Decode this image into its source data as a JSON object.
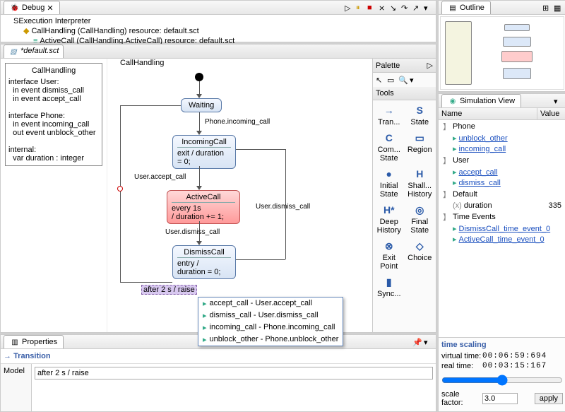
{
  "debug": {
    "title": "Debug",
    "tree": [
      {
        "icon": "▢",
        "text": "SExecution Interpreter",
        "indent": 0
      },
      {
        "icon": "◆",
        "text": "CallHandling  (CallHandling) resource: default.sct",
        "indent": 1
      },
      {
        "icon": "≡",
        "text": "ActiveCall  (CallHandling.ActiveCall) resource: default.sct",
        "indent": 2
      }
    ]
  },
  "outline": {
    "title": "Outline"
  },
  "simulation": {
    "title": "Simulation View",
    "cols": {
      "name": "Name",
      "value": "Value"
    },
    "rows": [
      {
        "type": "grp",
        "indent": 0,
        "icon": "】",
        "text": "Phone"
      },
      {
        "type": "link",
        "indent": 1,
        "icon": "▸",
        "text": "unblock_other"
      },
      {
        "type": "link",
        "indent": 1,
        "icon": "▸",
        "text": "incoming_call"
      },
      {
        "type": "grp",
        "indent": 0,
        "icon": "】",
        "text": "User"
      },
      {
        "type": "link",
        "indent": 1,
        "icon": "▸",
        "text": "accept_call"
      },
      {
        "type": "link",
        "indent": 1,
        "icon": "▸",
        "text": "dismiss_call"
      },
      {
        "type": "grp",
        "indent": 0,
        "icon": "】",
        "text": "Default"
      },
      {
        "type": "val",
        "indent": 1,
        "icon": "(x)",
        "text": "duration",
        "value": "335"
      },
      {
        "type": "grp",
        "indent": 0,
        "icon": "】",
        "text": "Time Events"
      },
      {
        "type": "link",
        "indent": 1,
        "icon": "▸",
        "text": "DismissCall_time_event_0"
      },
      {
        "type": "link",
        "indent": 1,
        "icon": "▸",
        "text": "ActiveCall_time_event_0"
      }
    ],
    "time_scaling": {
      "title": "time scaling",
      "virtual_label": "virtual time:",
      "virtual_value": "00:06:59:694",
      "real_label": "real time:",
      "real_value": "00:03:15:167",
      "scale_label": "scale factor:",
      "scale_value": "3.0",
      "apply": "apply"
    }
  },
  "editor": {
    "tab": "*default.sct",
    "diagram_title": "CallHandling",
    "interface": {
      "title": "CallHandling",
      "body": "interface User:\n  in event dismiss_call\n  in event accept_call\n\ninterface Phone:\n  in event incoming_call\n  out event unblock_other\n\ninternal:\n  var duration : integer"
    },
    "states": {
      "waiting": "Waiting",
      "incoming": {
        "title": "IncomingCall",
        "body": "exit / duration\n= 0;"
      },
      "active": {
        "title": "ActiveCall",
        "body": "every 1s\n/ duration += 1;"
      },
      "dismiss": {
        "title": "DismissCall",
        "body": "entry /\nduration = 0;"
      }
    },
    "labels": {
      "incoming_call": "Phone.incoming_call",
      "accept_call": "User.accept_call",
      "dismiss_call1": "User.dismiss_call",
      "dismiss_call2": "User.dismiss_call",
      "selected": "after 2 s / raise"
    }
  },
  "palette": {
    "title": "Palette",
    "tools_hdr": "Tools",
    "items": [
      {
        "label": "Tran...",
        "pic": "→"
      },
      {
        "label": "State",
        "pic": "S"
      },
      {
        "label": "Com...\nState",
        "pic": "C"
      },
      {
        "label": "Region",
        "pic": "▭"
      },
      {
        "label": "Initial\nState",
        "pic": "●"
      },
      {
        "label": "Shall...\nHistory",
        "pic": "H"
      },
      {
        "label": "Deep\nHistory",
        "pic": "H*"
      },
      {
        "label": "Final\nState",
        "pic": "◎"
      },
      {
        "label": "Exit\nPoint",
        "pic": "⊗"
      },
      {
        "label": "Choice",
        "pic": "◇"
      },
      {
        "label": "Sync...",
        "pic": "▮"
      }
    ]
  },
  "properties": {
    "title": "Properties",
    "section": "Transition",
    "tab": "Model",
    "expression": "after 2 s / raise "
  },
  "popup": {
    "items": [
      "accept_call - User.accept_call",
      "dismiss_call - User.dismiss_call",
      "incoming_call - Phone.incoming_call",
      "unblock_other - Phone.unblock_other"
    ]
  }
}
